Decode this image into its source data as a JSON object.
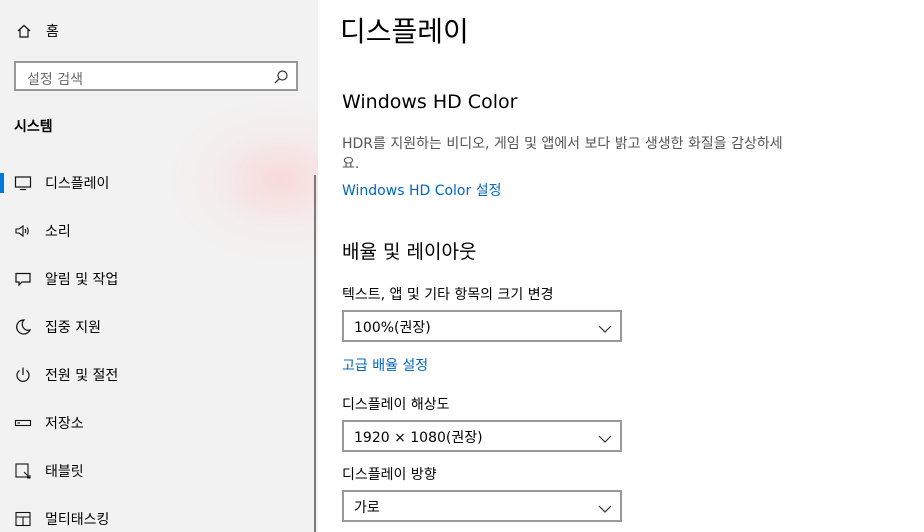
{
  "sidebar": {
    "home_label": "홈",
    "search_placeholder": "설정 검색",
    "section_title": "시스템",
    "items": [
      {
        "label": "디스플레이",
        "icon": "monitor-icon",
        "active": true
      },
      {
        "label": "소리",
        "icon": "speaker-icon",
        "active": false
      },
      {
        "label": "알림 및 작업",
        "icon": "message-icon",
        "active": false
      },
      {
        "label": "집중 지원",
        "icon": "moon-icon",
        "active": false
      },
      {
        "label": "전원 및 절전",
        "icon": "power-icon",
        "active": false
      },
      {
        "label": "저장소",
        "icon": "drive-icon",
        "active": false
      },
      {
        "label": "태블릿",
        "icon": "tablet-icon",
        "active": false
      },
      {
        "label": "멀티태스킹",
        "icon": "multitask-icon",
        "active": false
      }
    ],
    "accent_color": "#0078d7"
  },
  "main": {
    "page_title": "디스플레이",
    "hdr": {
      "heading": "Windows HD Color",
      "description": "HDR를 지원하는 비디오, 게임 및 앱에서 보다 밝고 생생한 화질을 감상하세요.",
      "link": "Windows HD Color 설정"
    },
    "scale_layout": {
      "heading": "배율 및 레이아웃",
      "scale_label": "텍스트, 앱 및 기타 항목의 크기 변경",
      "scale_value": "100%(권장)",
      "advanced_link": "고급 배율 설정",
      "resolution_label": "디스플레이 해상도",
      "resolution_value": "1920 × 1080(권장)",
      "orientation_label": "디스플레이 방향",
      "orientation_value": "가로"
    },
    "link_color": "#0067c0"
  }
}
